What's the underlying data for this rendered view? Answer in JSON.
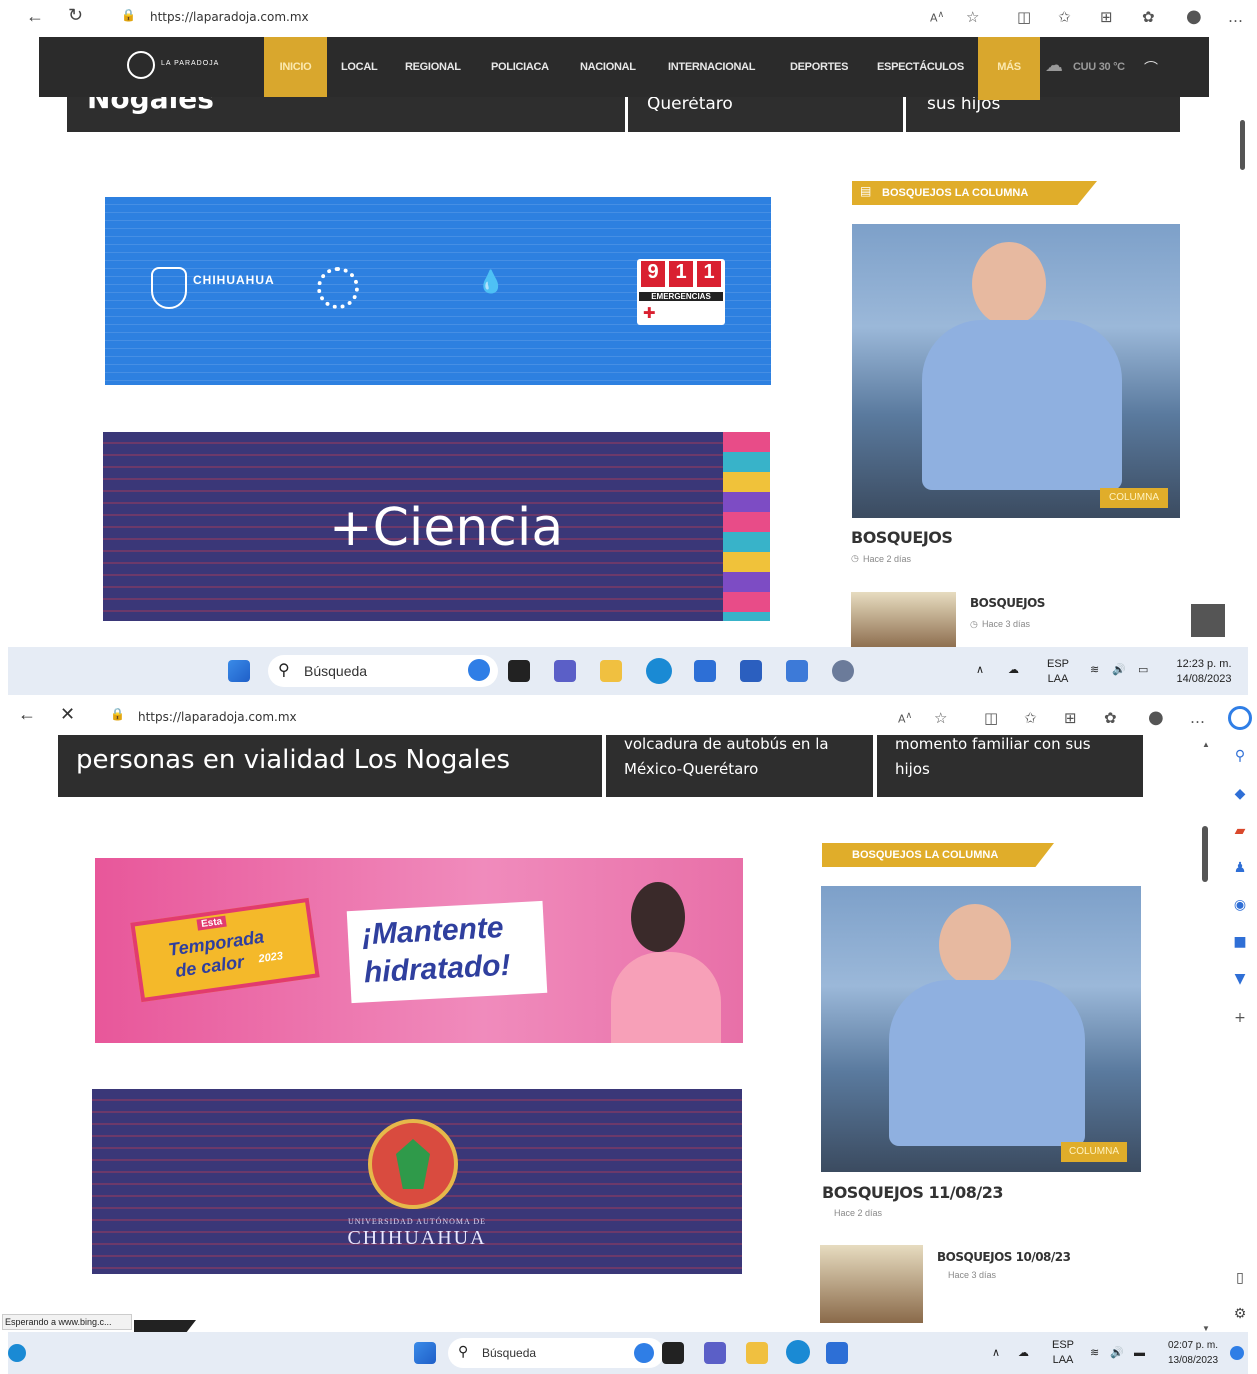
{
  "top": {
    "address": "https://laparadoja.com.mx",
    "nav": {
      "logo_text": "LA PARADOJA",
      "items": [
        "INICIO",
        "LOCAL",
        "REGIONAL",
        "POLICIACA",
        "NACIONAL",
        "INTERNACIONAL",
        "DEPORTES",
        "ESPECTÁCULOS",
        "MÁS"
      ],
      "weather": "CUU 30 °C"
    },
    "strip": {
      "left": "Nogales",
      "mid": "Querétaro",
      "right": "sus hijos"
    },
    "banner1": {
      "brand": "CHIHUAHUA",
      "emergency": "911",
      "emergency_label": "EMERGENCIAS",
      "digits": [
        "9",
        "1",
        "1"
      ]
    },
    "banner2": {
      "text": "+Ciencia"
    },
    "sidebar": {
      "label": "BOSQUEJOS LA COLUMNA",
      "tag": "COLUMNA",
      "title": "BOSQUEJOS",
      "time": "Hace 2 días",
      "item2_title": "BOSQUEJOS",
      "item2_time": "Hace 3 días"
    },
    "taskbar": {
      "search": "Búsqueda",
      "lang1": "ESP",
      "lang2": "LAA",
      "time": "12:23 p. m.",
      "date": "14/08/2023"
    }
  },
  "bottom": {
    "address": "https://laparadoja.com.mx",
    "strip": {
      "left": "personas en vialidad Los Nogales",
      "mid1": "volcadura de autobús en la",
      "mid2": "México-Querétaro",
      "right1": "momento familiar con sus",
      "right2": "hijos"
    },
    "banner1": {
      "badge_top": "Esta",
      "badge_mid": "Temporada",
      "badge_bot": "de calor",
      "badge_year": "2023",
      "line1": "¡Mantente",
      "line2": "hidratado!"
    },
    "banner2": {
      "line1": "UNIVERSIDAD AUTÓNOMA DE",
      "line2": "CHIHUAHUA"
    },
    "sidebar": {
      "label": "BOSQUEJOS LA COLUMNA",
      "tag": "COLUMNA",
      "title": "BOSQUEJOS 11/08/23",
      "time": "Hace 2 días",
      "item2_title": "BOSQUEJOS 10/08/23",
      "item2_time": "Hace 3 días"
    },
    "status": "Esperando a www.bing.c...",
    "taskbar": {
      "search": "Búsqueda",
      "lang1": "ESP",
      "lang2": "LAA",
      "time": "02:07 p. m.",
      "date": "13/08/2023"
    }
  }
}
